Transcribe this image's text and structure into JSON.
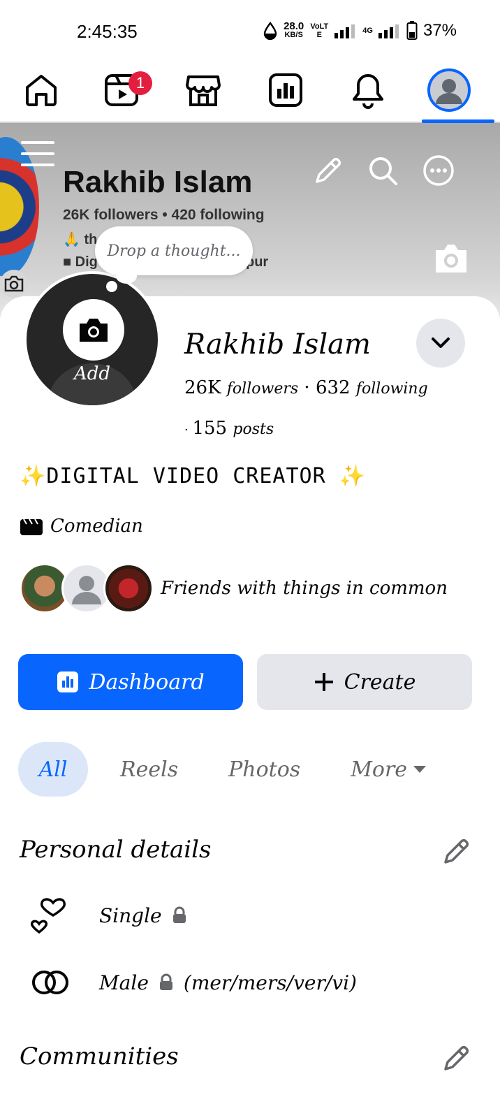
{
  "status_bar": {
    "time": "2:45:35",
    "net_speed": "28.0",
    "net_unit": "KB/S",
    "volte": "VoLTE",
    "network": "4G",
    "battery": "37%"
  },
  "nav": {
    "items": [
      "home-icon",
      "video-icon",
      "marketplace-icon",
      "dashboard-icon",
      "bell-icon",
      "profile-icon"
    ],
    "video_badge": "1",
    "active": "profile-icon",
    "active_color": "#0866ff"
  },
  "cover": {
    "name": "Rakhib Islam",
    "stats": "26K followers • 420 following",
    "line2_fragment": "th",
    "line3_fragment": "Dig",
    "line3_end": "pur"
  },
  "thought_bubble": {
    "placeholder": "Drop a thought..."
  },
  "profile": {
    "avatar_label": "Add",
    "name": "Rakhib Islam",
    "followers_count": "26K",
    "followers_label": "followers",
    "following_count": "632",
    "following_label": "following",
    "posts_count": "155",
    "posts_label": "posts",
    "bio": "✨DIGITAL VIDEO CREATOR ✨",
    "category": "Comedian",
    "friends_text": "Friends with things in common"
  },
  "actions": {
    "dashboard_label": "Dashboard",
    "create_label": "Create",
    "primary_color": "#0866ff",
    "secondary_color": "#e4e6eb"
  },
  "tabs": {
    "all": "All",
    "reels": "Reels",
    "photos": "Photos",
    "more": "More"
  },
  "personal_details": {
    "title": "Personal details",
    "relationship": "Single",
    "gender": "Male",
    "pronouns": "(mer/mers/ver/vi)"
  },
  "communities": {
    "title": "Communities"
  }
}
